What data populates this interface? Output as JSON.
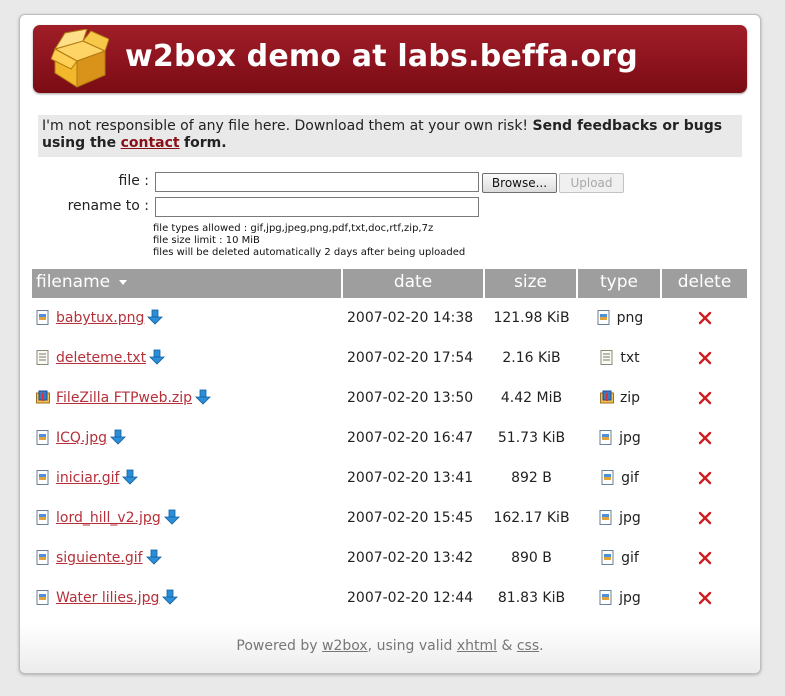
{
  "header": {
    "title": "w2box demo at labs.beffa.org",
    "logo_icon": "box-icon"
  },
  "notice": {
    "text": "I'm not responsible of any file here. Download them at your own risk!",
    "bold_prefix": "Send feedbacks or bugs using the",
    "link_label": "contact",
    "bold_suffix": "form."
  },
  "upload_form": {
    "file_label": "file :",
    "file_value": "",
    "browse_label": "Browse...",
    "upload_label": "Upload",
    "rename_label": "rename to :",
    "rename_value": "",
    "limits": [
      "file types allowed : gif,jpg,jpeg,png,pdf,txt,doc,rtf,zip,7z",
      "file size limit : 10 MiB",
      "files will be deleted automatically 2 days after being uploaded"
    ]
  },
  "table": {
    "headers": {
      "filename": "filename",
      "sort_icon": "sort-down-icon",
      "date": "date",
      "size": "size",
      "type": "type",
      "delete": "delete"
    },
    "rows": [
      {
        "name": "babytux.png",
        "date": "2007-02-20 14:38",
        "size": "121.98 KiB",
        "type": "png",
        "icon": "image-file-icon"
      },
      {
        "name": "deleteme.txt",
        "date": "2007-02-20 17:54",
        "size": "2.16 KiB",
        "type": "txt",
        "icon": "text-file-icon"
      },
      {
        "name": "FileZilla FTPweb.zip",
        "date": "2007-02-20 13:50",
        "size": "4.42 MiB",
        "type": "zip",
        "icon": "archive-file-icon"
      },
      {
        "name": "ICQ.jpg",
        "date": "2007-02-20 16:47",
        "size": "51.73 KiB",
        "type": "jpg",
        "icon": "image-file-icon"
      },
      {
        "name": "iniciar.gif",
        "date": "2007-02-20 13:41",
        "size": "892 B",
        "type": "gif",
        "icon": "image-file-icon"
      },
      {
        "name": "lord_hill_v2.jpg",
        "date": "2007-02-20 15:45",
        "size": "162.17 KiB",
        "type": "jpg",
        "icon": "image-file-icon"
      },
      {
        "name": "siguiente.gif",
        "date": "2007-02-20 13:42",
        "size": "890 B",
        "type": "gif",
        "icon": "image-file-icon"
      },
      {
        "name": "Water lilies.jpg",
        "date": "2007-02-20 12:44",
        "size": "81.83 KiB",
        "type": "jpg",
        "icon": "image-file-icon"
      }
    ]
  },
  "footer": {
    "prefix": "Powered by",
    "w2box_link": "w2box",
    "middle": ", using valid",
    "xhtml_link": "xhtml",
    "amp": "&",
    "css_link": "css",
    "end": "."
  },
  "colors": {
    "banner": "#901520",
    "link": "#b5303a",
    "header_bg": "#9e9e9e",
    "delete_x": "#cc1f1f",
    "download_arrow": "#2a8fd8"
  }
}
